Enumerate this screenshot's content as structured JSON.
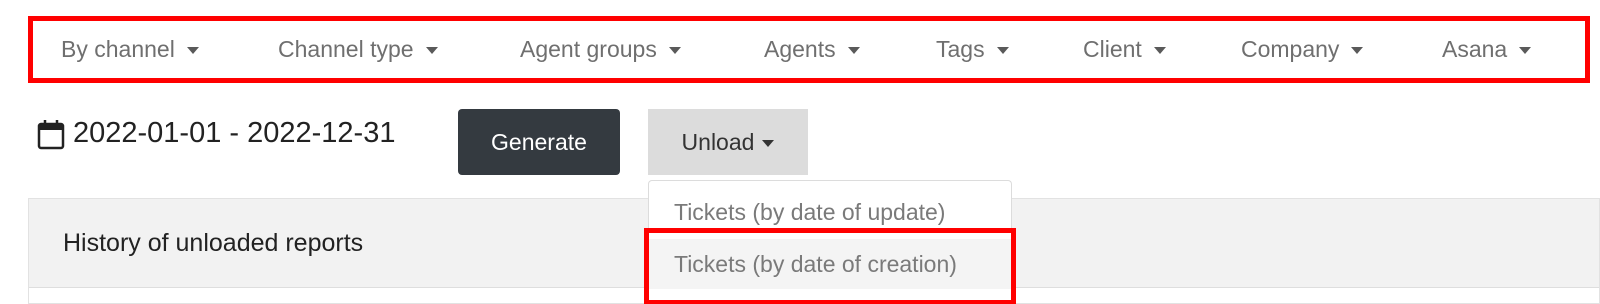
{
  "filters": [
    {
      "label": "By channel"
    },
    {
      "label": "Channel type"
    },
    {
      "label": "Agent groups"
    },
    {
      "label": "Agents"
    },
    {
      "label": "Tags"
    },
    {
      "label": "Client"
    },
    {
      "label": "Company"
    },
    {
      "label": "Asana"
    }
  ],
  "date_range": "2022-01-01 - 2022-12-31",
  "buttons": {
    "generate": "Generate",
    "unload": "Unload"
  },
  "unload_menu": {
    "items": [
      {
        "label": "Tickets (by date of update)"
      },
      {
        "label": "Tickets (by date of creation)"
      }
    ]
  },
  "history": {
    "title": "History of unloaded reports"
  },
  "icons": {
    "date": "calendar-icon",
    "dropdown": "caret-down-icon"
  },
  "colors": {
    "highlight": "#ff0000",
    "generate_bg": "#343a40",
    "unload_bg": "#dcdcdc"
  }
}
